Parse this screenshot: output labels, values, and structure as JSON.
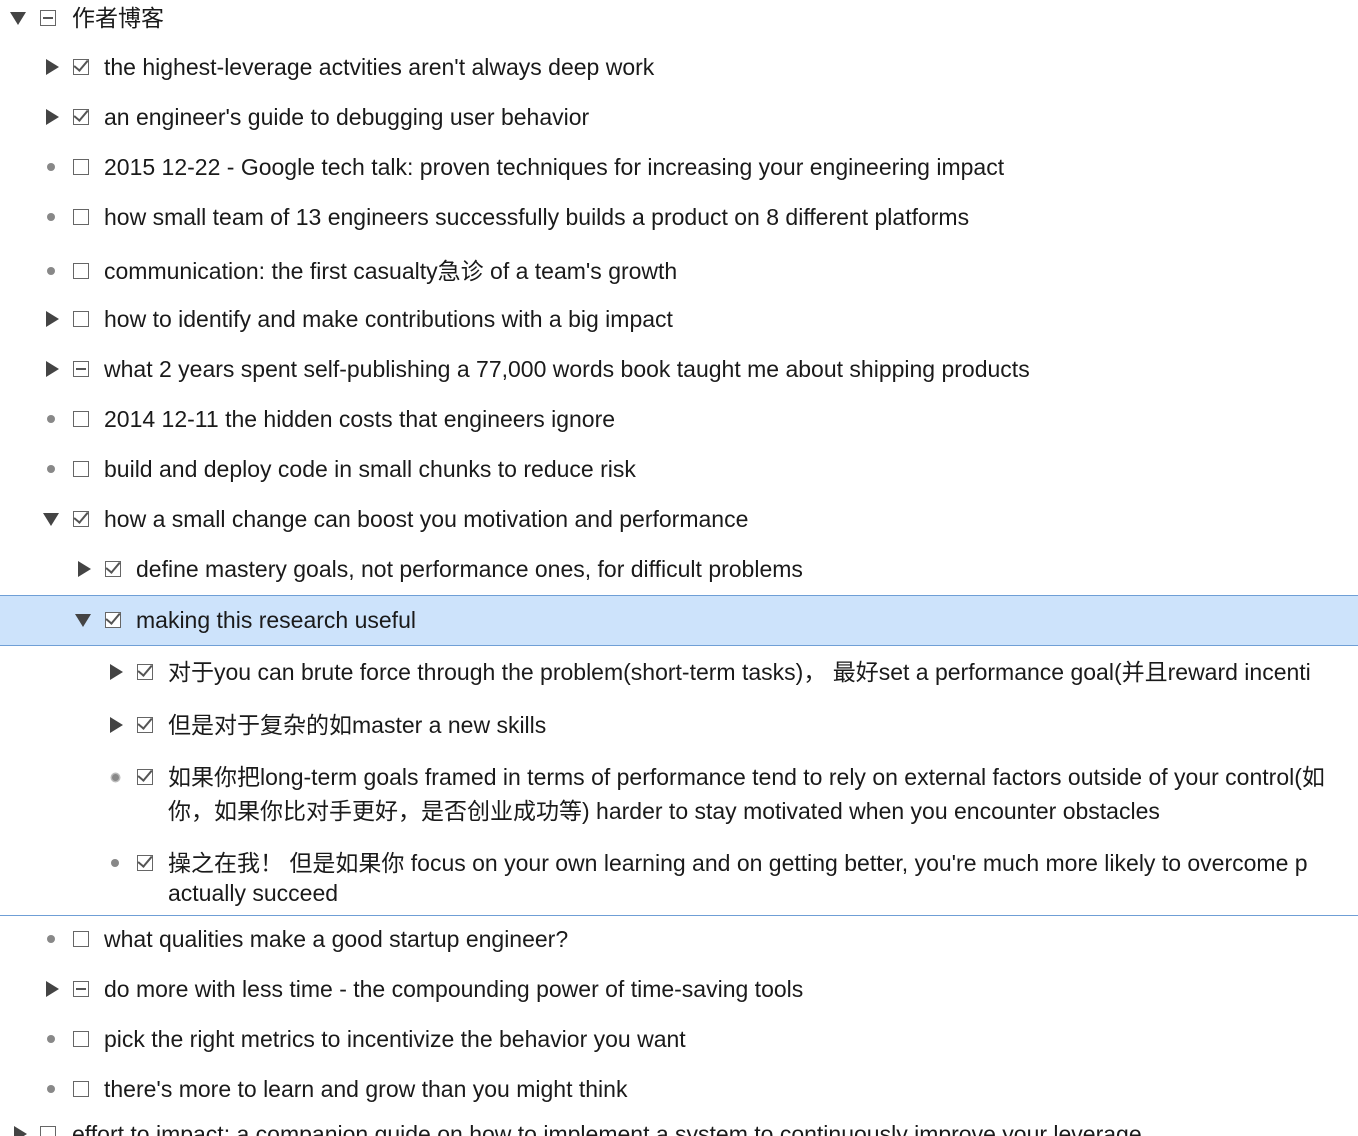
{
  "root": {
    "label": "作者博客",
    "expanded": true,
    "state": "partial"
  },
  "items": [
    {
      "label": "the highest-leverage actvities aren't always deep work",
      "control": "collapsed",
      "state": "checked"
    },
    {
      "label": "an engineer's guide to debugging user behavior",
      "control": "collapsed",
      "state": "checked"
    },
    {
      "label": "2015 12-22 - Google tech talk: proven techniques for increasing your engineering impact",
      "control": "leaf",
      "state": "unchecked"
    },
    {
      "label": "how small team of 13 engineers successfully builds a product on 8 different platforms",
      "control": "leaf",
      "state": "unchecked"
    },
    {
      "label": "communication: the first casualty急诊 of a team's growth",
      "control": "leaf",
      "state": "unchecked"
    },
    {
      "label": "how to identify and make contributions with a big impact",
      "control": "collapsed",
      "state": "unchecked"
    },
    {
      "label": "what 2 years spent self-publishing a 77,000 words book taught me about shipping products",
      "control": "collapsed",
      "state": "partial"
    },
    {
      "label": "2014 12-11 the hidden costs that engineers ignore",
      "control": "leaf",
      "state": "unchecked"
    },
    {
      "label": "build and deploy code in small chunks to reduce risk",
      "control": "leaf",
      "state": "unchecked"
    },
    {
      "label": "how a small change can boost you motivation and performance",
      "control": "expanded",
      "state": "checked"
    },
    {
      "label": "define mastery goals, not performance ones, for difficult problems",
      "control": "collapsed",
      "state": "checked"
    },
    {
      "label": "making this research useful",
      "control": "expanded",
      "state": "checked",
      "selected": true
    },
    {
      "label": "对于you can brute force through the problem(short-term tasks)， 最好set a performance goal(并且reward incenti",
      "control": "collapsed",
      "state": "checked"
    },
    {
      "label": "但是对于复杂的如master a new skills",
      "control": "collapsed",
      "state": "checked"
    },
    {
      "label": "如果你把long-term goals framed in terms of performance tend to rely on external factors outside of your control(如",
      "label2": "你，如果你比对手更好，是否创业成功等) harder to stay motivated when you encounter obstacles",
      "control": "leaf",
      "state": "checked"
    },
    {
      "label": "操之在我！ 但是如果你 focus on your own learning and on getting better, you're much more likely to overcome p",
      "label2": "actually succeed",
      "control": "leaf",
      "state": "checked"
    },
    {
      "label": "what qualities make a good startup engineer?",
      "control": "leaf",
      "state": "unchecked"
    },
    {
      "label": "do more with less time - the compounding power of time-saving tools",
      "control": "collapsed",
      "state": "partial"
    },
    {
      "label": "pick the right metrics to incentivize the behavior you want",
      "control": "leaf",
      "state": "unchecked"
    },
    {
      "label": "there's more to learn and grow than you might think",
      "control": "leaf",
      "state": "unchecked"
    },
    {
      "label": "effort to impact: a companion guide on how to implement a system to continuously improve your leverage",
      "control": "collapsed",
      "state": "unchecked"
    }
  ]
}
